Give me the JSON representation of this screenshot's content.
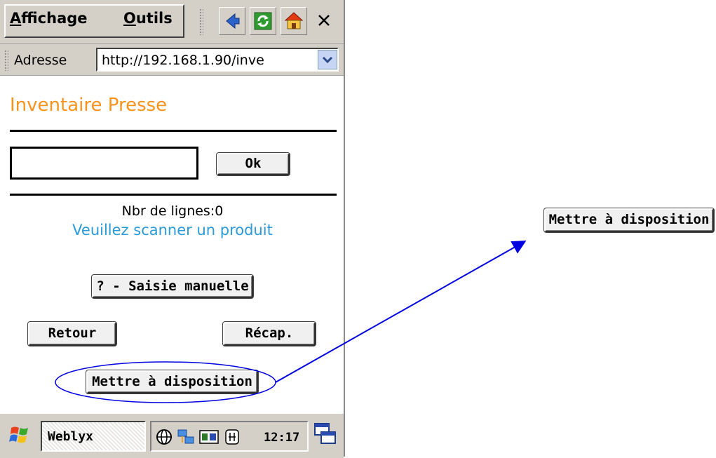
{
  "menubar": {
    "affichage_hotkey": "A",
    "affichage_rest": "ffichage",
    "outils_hotkey": "O",
    "outils_rest": "utils"
  },
  "address": {
    "label": "Adresse",
    "url": "http://192.168.1.90/inve"
  },
  "page": {
    "title": "Inventaire Presse",
    "ok_label": "Ok",
    "line_count": "Nbr de lignes:0",
    "scan_message": "Veuillez scanner un produit",
    "manual_label": "? - Saisie manuelle",
    "retour_label": "Retour",
    "recap_label": "Récap.",
    "dispo_label": "Mettre à disposition"
  },
  "taskbar": {
    "task_label": "Weblyx",
    "clock": "12:17"
  },
  "annotation": {
    "zoom_label": "Mettre à disposition",
    "color": "#0000e0"
  },
  "colors": {
    "title": "#f7941d",
    "scan_message": "#2a9ad8",
    "chrome": "#d4d0c8"
  }
}
